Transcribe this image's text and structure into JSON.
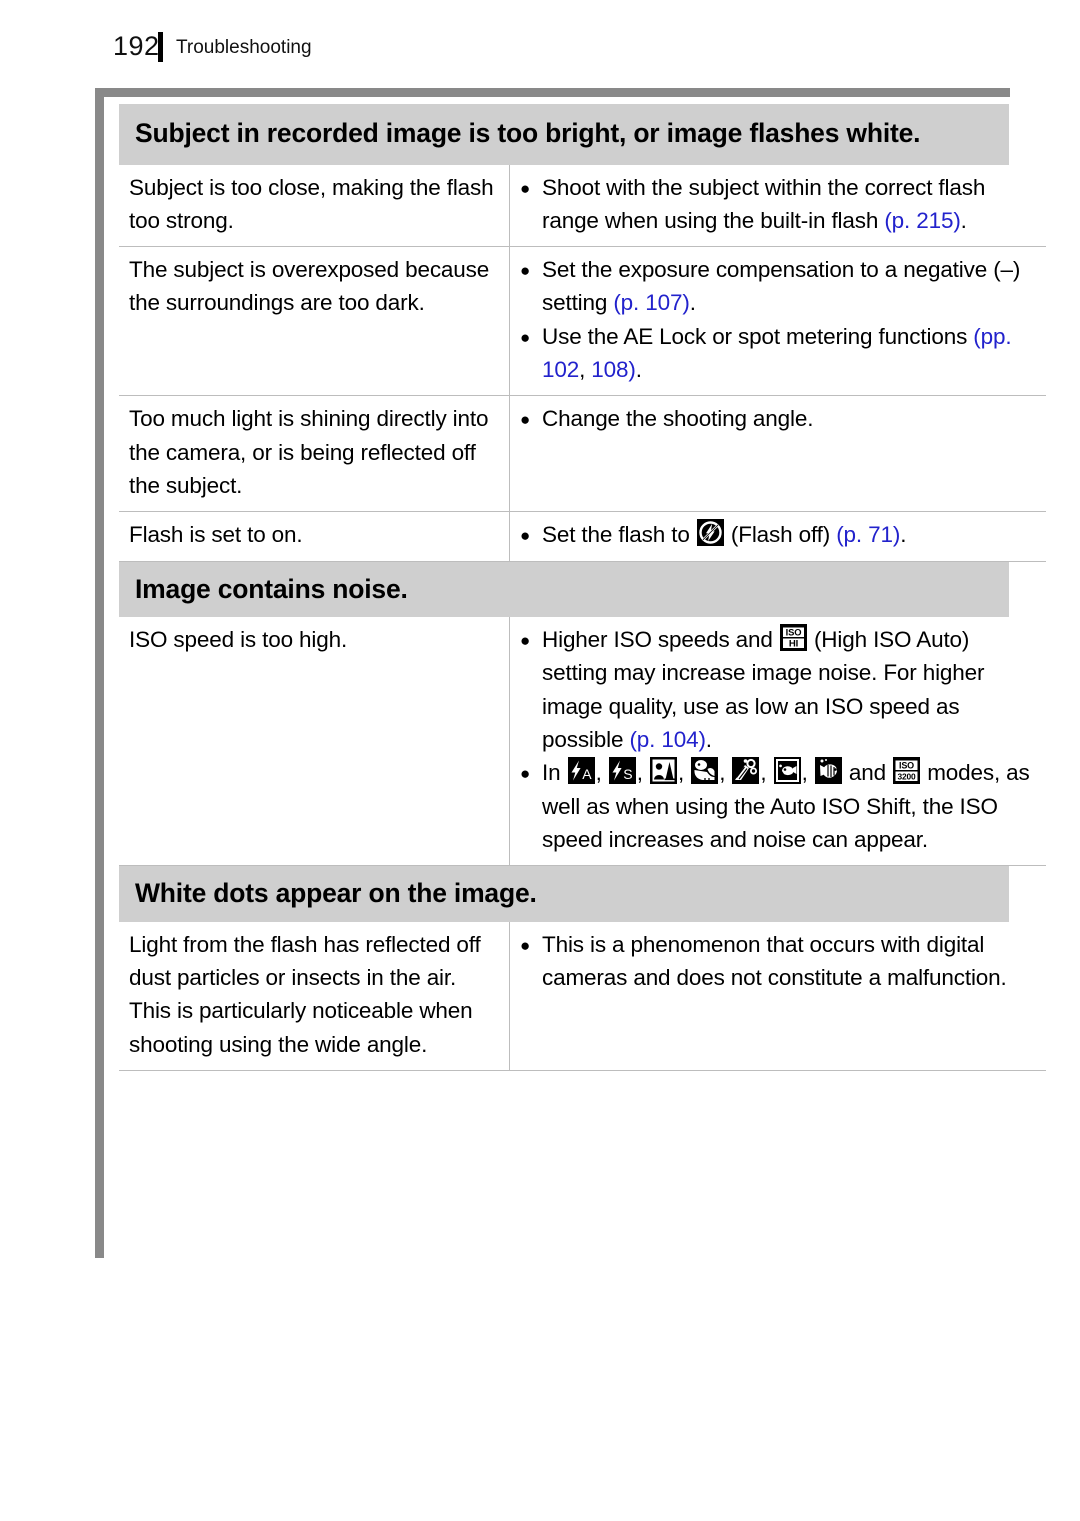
{
  "page": {
    "number": "192",
    "running_head": "Troubleshooting"
  },
  "colors": {
    "section_band": "#cfcfcf",
    "frame_gray": "#898989",
    "reference_link": "#2222cc",
    "rule": "#bdbdbd"
  },
  "sections": [
    {
      "heading": "Subject in recorded image is too bright, or image flashes white.",
      "rows": [
        {
          "cause": "Subject is too close, making the flash too strong.",
          "remedy_pre": "Shoot with the subject within the correct flash range when using the built-in flash ",
          "remedy_ref": "(p. 215)",
          "remedy_post": "."
        },
        {
          "cause": "The subject is overexposed because the surroundings are too dark.",
          "remedy_1_pre": "Set the exposure compensation to a negative (–) setting ",
          "remedy_1_ref": "(p. 107)",
          "remedy_1_post": ".",
          "remedy_2_pre": "Use the AE Lock or spot metering functions ",
          "remedy_2_ref_a": "(pp. 102",
          "remedy_2_mid": ", ",
          "remedy_2_ref_b": "108)",
          "remedy_2_post": "."
        },
        {
          "cause": "Too much light is shining directly into the camera, or is being reflected off the subject.",
          "remedy": "Change the shooting angle."
        },
        {
          "cause": "Flash is set to on.",
          "remedy_pre": "Set the flash to ",
          "remedy_icon": "flash-off-icon",
          "remedy_mid": " (Flash off) ",
          "remedy_ref": "(p. 71)",
          "remedy_post": "."
        }
      ]
    },
    {
      "heading": "Image contains noise.",
      "rows": [
        {
          "cause": "ISO speed is too high.",
          "remedy_1_pre": "Higher ISO speeds and ",
          "remedy_1_icon": "iso-hi-icon",
          "remedy_1_mid": " (High ISO Auto) setting may increase image noise. For higher image quality, use as low an ISO speed as possible ",
          "remedy_1_ref": "(p. 104)",
          "remedy_1_post": ".",
          "remedy_2_pre": "In ",
          "remedy_2_icons": [
            "flash-auto-iso-icon",
            "flash-slow-sync-icon",
            "night-snapshot-icon",
            "kids-and-pets-icon",
            "indoor-icon",
            "aquarium-icon",
            "underwater-icon"
          ],
          "remedy_2_and": " and ",
          "remedy_2_icon_last": "iso-3200-icon",
          "remedy_2_post": " modes, as well as when using the Auto ISO Shift, the ISO speed increases and noise can appear."
        }
      ]
    },
    {
      "heading": "White dots appear on the image.",
      "rows": [
        {
          "cause": "Light from the flash has reflected off dust particles or insects in the air. This is particularly noticeable when shooting using the wide angle.",
          "remedy": "This is a phenomenon that occurs with digital cameras and does not constitute a malfunction."
        }
      ]
    }
  ]
}
